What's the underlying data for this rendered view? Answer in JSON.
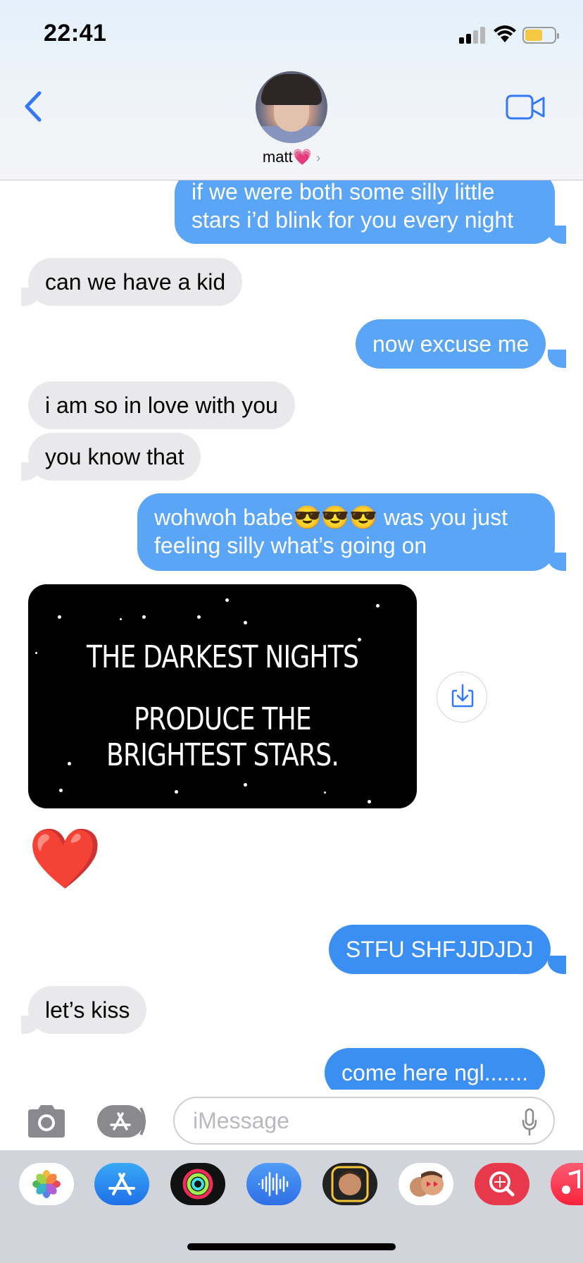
{
  "status_bar": {
    "time": "22:41"
  },
  "contact": {
    "name": "matt",
    "emoji": "💗"
  },
  "messages": [
    {
      "sender": "me",
      "text_line1": "if we were both some silly little",
      "text_line2": "stars i’d blink for you every night"
    },
    {
      "sender": "them",
      "text": "can we have a kid"
    },
    {
      "sender": "me",
      "text": "now excuse me"
    },
    {
      "sender": "them",
      "text": "i am so in love with you"
    },
    {
      "sender": "them",
      "text": "you know that"
    },
    {
      "sender": "me",
      "text_line1": "wohwoh babe😎😎😎 was you just",
      "text_line2": "feeling silly what’s going on"
    },
    {
      "sender": "them",
      "image_line1": "THE DARKEST NIGHTS",
      "image_line2": "PRODUCE THE BRIGHTEST STARS."
    },
    {
      "sender": "them",
      "emoji": "❤️"
    },
    {
      "sender": "me",
      "text": "STFU SHFJJDJDJ"
    },
    {
      "sender": "them",
      "text": "let’s kiss"
    },
    {
      "sender": "me",
      "text": "come here ngl......."
    }
  ],
  "input": {
    "placeholder": "iMessage"
  },
  "app_drawer": [
    "photos-app",
    "app-store-app",
    "activity-app",
    "audio-message-app",
    "memoji-app",
    "animoji-app",
    "images-search-app",
    "music-app"
  ],
  "colors": {
    "outgoing_bubble": "#3b8ff3",
    "incoming_bubble": "#e9e9eb",
    "accent": "#3478f6"
  }
}
